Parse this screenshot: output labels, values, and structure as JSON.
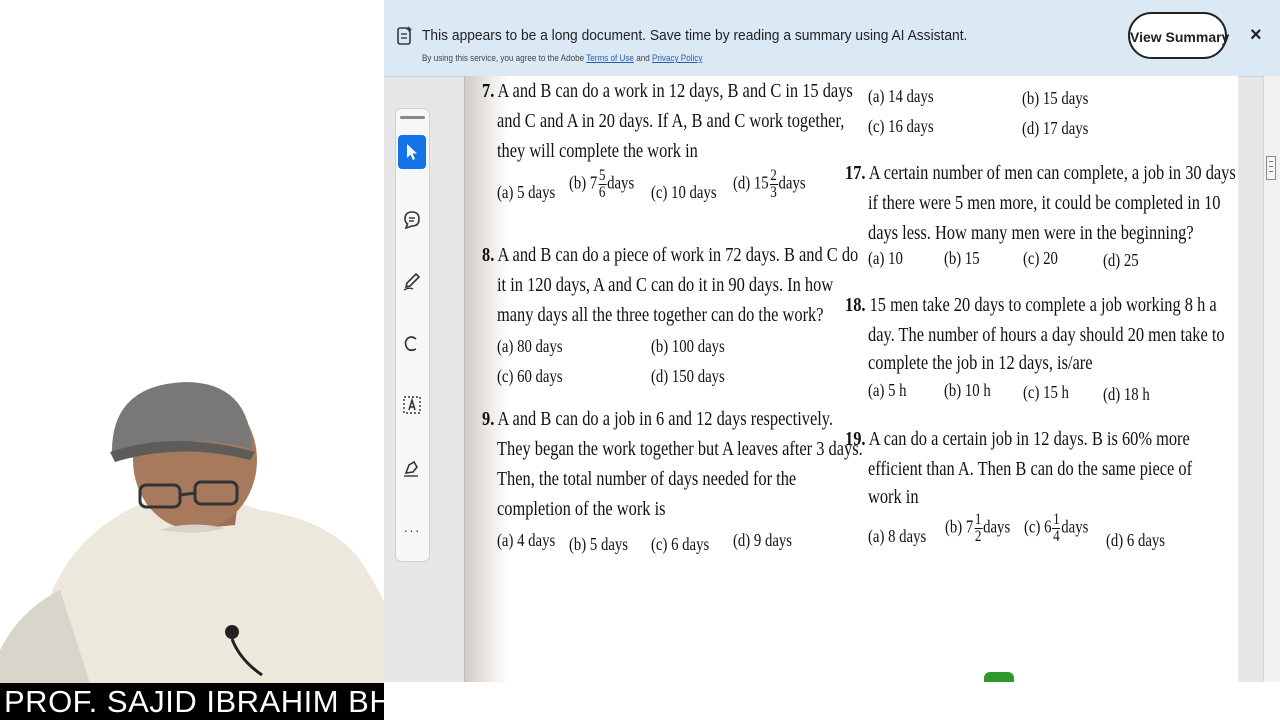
{
  "banner": {
    "message": "This appears to be a long document. Save time by reading a summary using AI Assistant.",
    "legal_prefix": "By using this service, you agree to the Adobe",
    "terms": "Terms of Use",
    "and": "and",
    "privacy": "Privacy Policy",
    "view_summary": "View Summary",
    "close": "×"
  },
  "toolbar": {
    "tools": [
      "select-tool",
      "comment-tool",
      "draw-tool",
      "highlight-tool",
      "text-select-tool",
      "fill-sign-tool"
    ],
    "more": "···"
  },
  "caption": "PROF. SAJID IBRAHIM BHATI",
  "questions": {
    "q7": {
      "num": "7.",
      "lines": [
        "A and B can do a work in 12 days, B and C in 15 days",
        "and C and A in 20 days. If A, B and C work together,",
        "they will complete the work in"
      ],
      "a": "(a) 5 days",
      "b_pre": "(b) 7",
      "b_num": "5",
      "b_den": "6",
      "b_post": "days",
      "c": "(c) 10 days",
      "d_pre": "(d) 15",
      "d_num": "2",
      "d_den": "3",
      "d_post": "days"
    },
    "q8": {
      "num": "8.",
      "lines": [
        "A and B can do a piece of work in 72 days. B and C do",
        "it in 120 days, A and C can do it in 90 days. In how",
        "many days all the three together can do the work?"
      ],
      "a": "(a) 80 days",
      "b": "(b) 100 days",
      "c": "(c) 60 days",
      "d": "(d) 150 days"
    },
    "q9": {
      "num": "9.",
      "lines": [
        "A and B can do a job in 6 and 12 days respectively.",
        "They began the work together but A leaves after 3 days.",
        "Then, the total number of days needed for the",
        "completion of the work is"
      ],
      "a": "(a) 4 days",
      "b": "(b) 5 days",
      "c": "(c) 6 days",
      "d": "(d) 9 days"
    },
    "q16": {
      "a": "(a) 14 days",
      "b": "(b) 15 days",
      "c": "(c) 16 days",
      "d": "(d) 17 days"
    },
    "q17": {
      "num": "17.",
      "lines": [
        "A certain number of men can complete, a job in 30 days",
        "if there were 5 men more, it could be completed in 10",
        "days less. How many men were in the beginning?"
      ],
      "a": "(a) 10",
      "b": "(b) 15",
      "c": "(c) 20",
      "d": "(d) 25"
    },
    "q18": {
      "num": "18.",
      "lines": [
        "15 men take 20 days to complete a job working  8 h a",
        "day. The number of hours a day should 20 men take to",
        "complete the job in 12 days, is/are"
      ],
      "a": "(a) 5 h",
      "b": "(b) 10 h",
      "c": "(c) 15 h",
      "d": "(d) 18 h"
    },
    "q19": {
      "num": "19.",
      "lines": [
        "A can do a certain job in 12 days. B is 60% more",
        "efficient than A. Then B can do the same piece of",
        "work in"
      ],
      "a": "(a) 8 days",
      "b_pre": "(b) 7",
      "b_num": "1",
      "b_den": "2",
      "b_post": "days",
      "c_pre": "(c) 6",
      "c_num": "1",
      "c_den": "4",
      "c_post": "days",
      "d": "(d) 6 days"
    }
  },
  "colors": {
    "banner_bg": "#dbe9f5",
    "active_tool": "#1473e6",
    "caption_bg": "#000000",
    "caption_fg": "#ffffff"
  }
}
